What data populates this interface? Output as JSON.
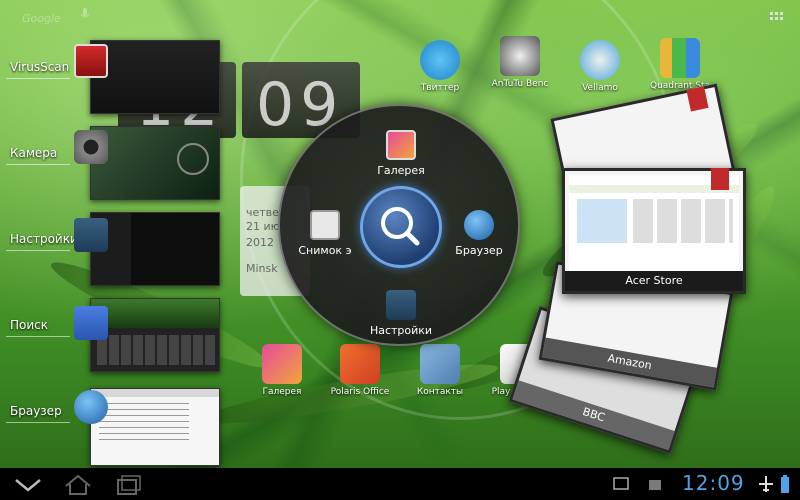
{
  "top_bar": {
    "search_label": "Google"
  },
  "recents": [
    {
      "label": "VirusScan"
    },
    {
      "label": "Камера"
    },
    {
      "label": "Настройки"
    },
    {
      "label": "Поиск"
    },
    {
      "label": "Браузер"
    }
  ],
  "clock_widget": {
    "hour": "12",
    "minute": "09",
    "date_line1": "четве",
    "date_line2": "21 ию",
    "date_line3": "2012",
    "city": "Minsk"
  },
  "desktop_icons": [
    {
      "label": "Твиттер"
    },
    {
      "label": "AnTuTu Benc"
    },
    {
      "label": "Vellamo"
    },
    {
      "label": "Quadrant Sta"
    }
  ],
  "dock_icons": [
    {
      "label": "Галерея"
    },
    {
      "label": "Polaris Office"
    },
    {
      "label": "Контакты"
    },
    {
      "label": "Play Маркет"
    }
  ],
  "ring_menu": {
    "top_label": "Галерея",
    "left_label": "Снимок э",
    "right_label": "Браузер",
    "bottom_label": "Настройки"
  },
  "cards": [
    {
      "title": "Acer Store"
    },
    {
      "title": "Amazon"
    },
    {
      "title": "BBC"
    }
  ],
  "system_bar": {
    "time": "12:09"
  },
  "colors": {
    "accent": "#4fa3e8",
    "ring_center": "#2a4f8a",
    "ribbon": "#c02a2a"
  }
}
